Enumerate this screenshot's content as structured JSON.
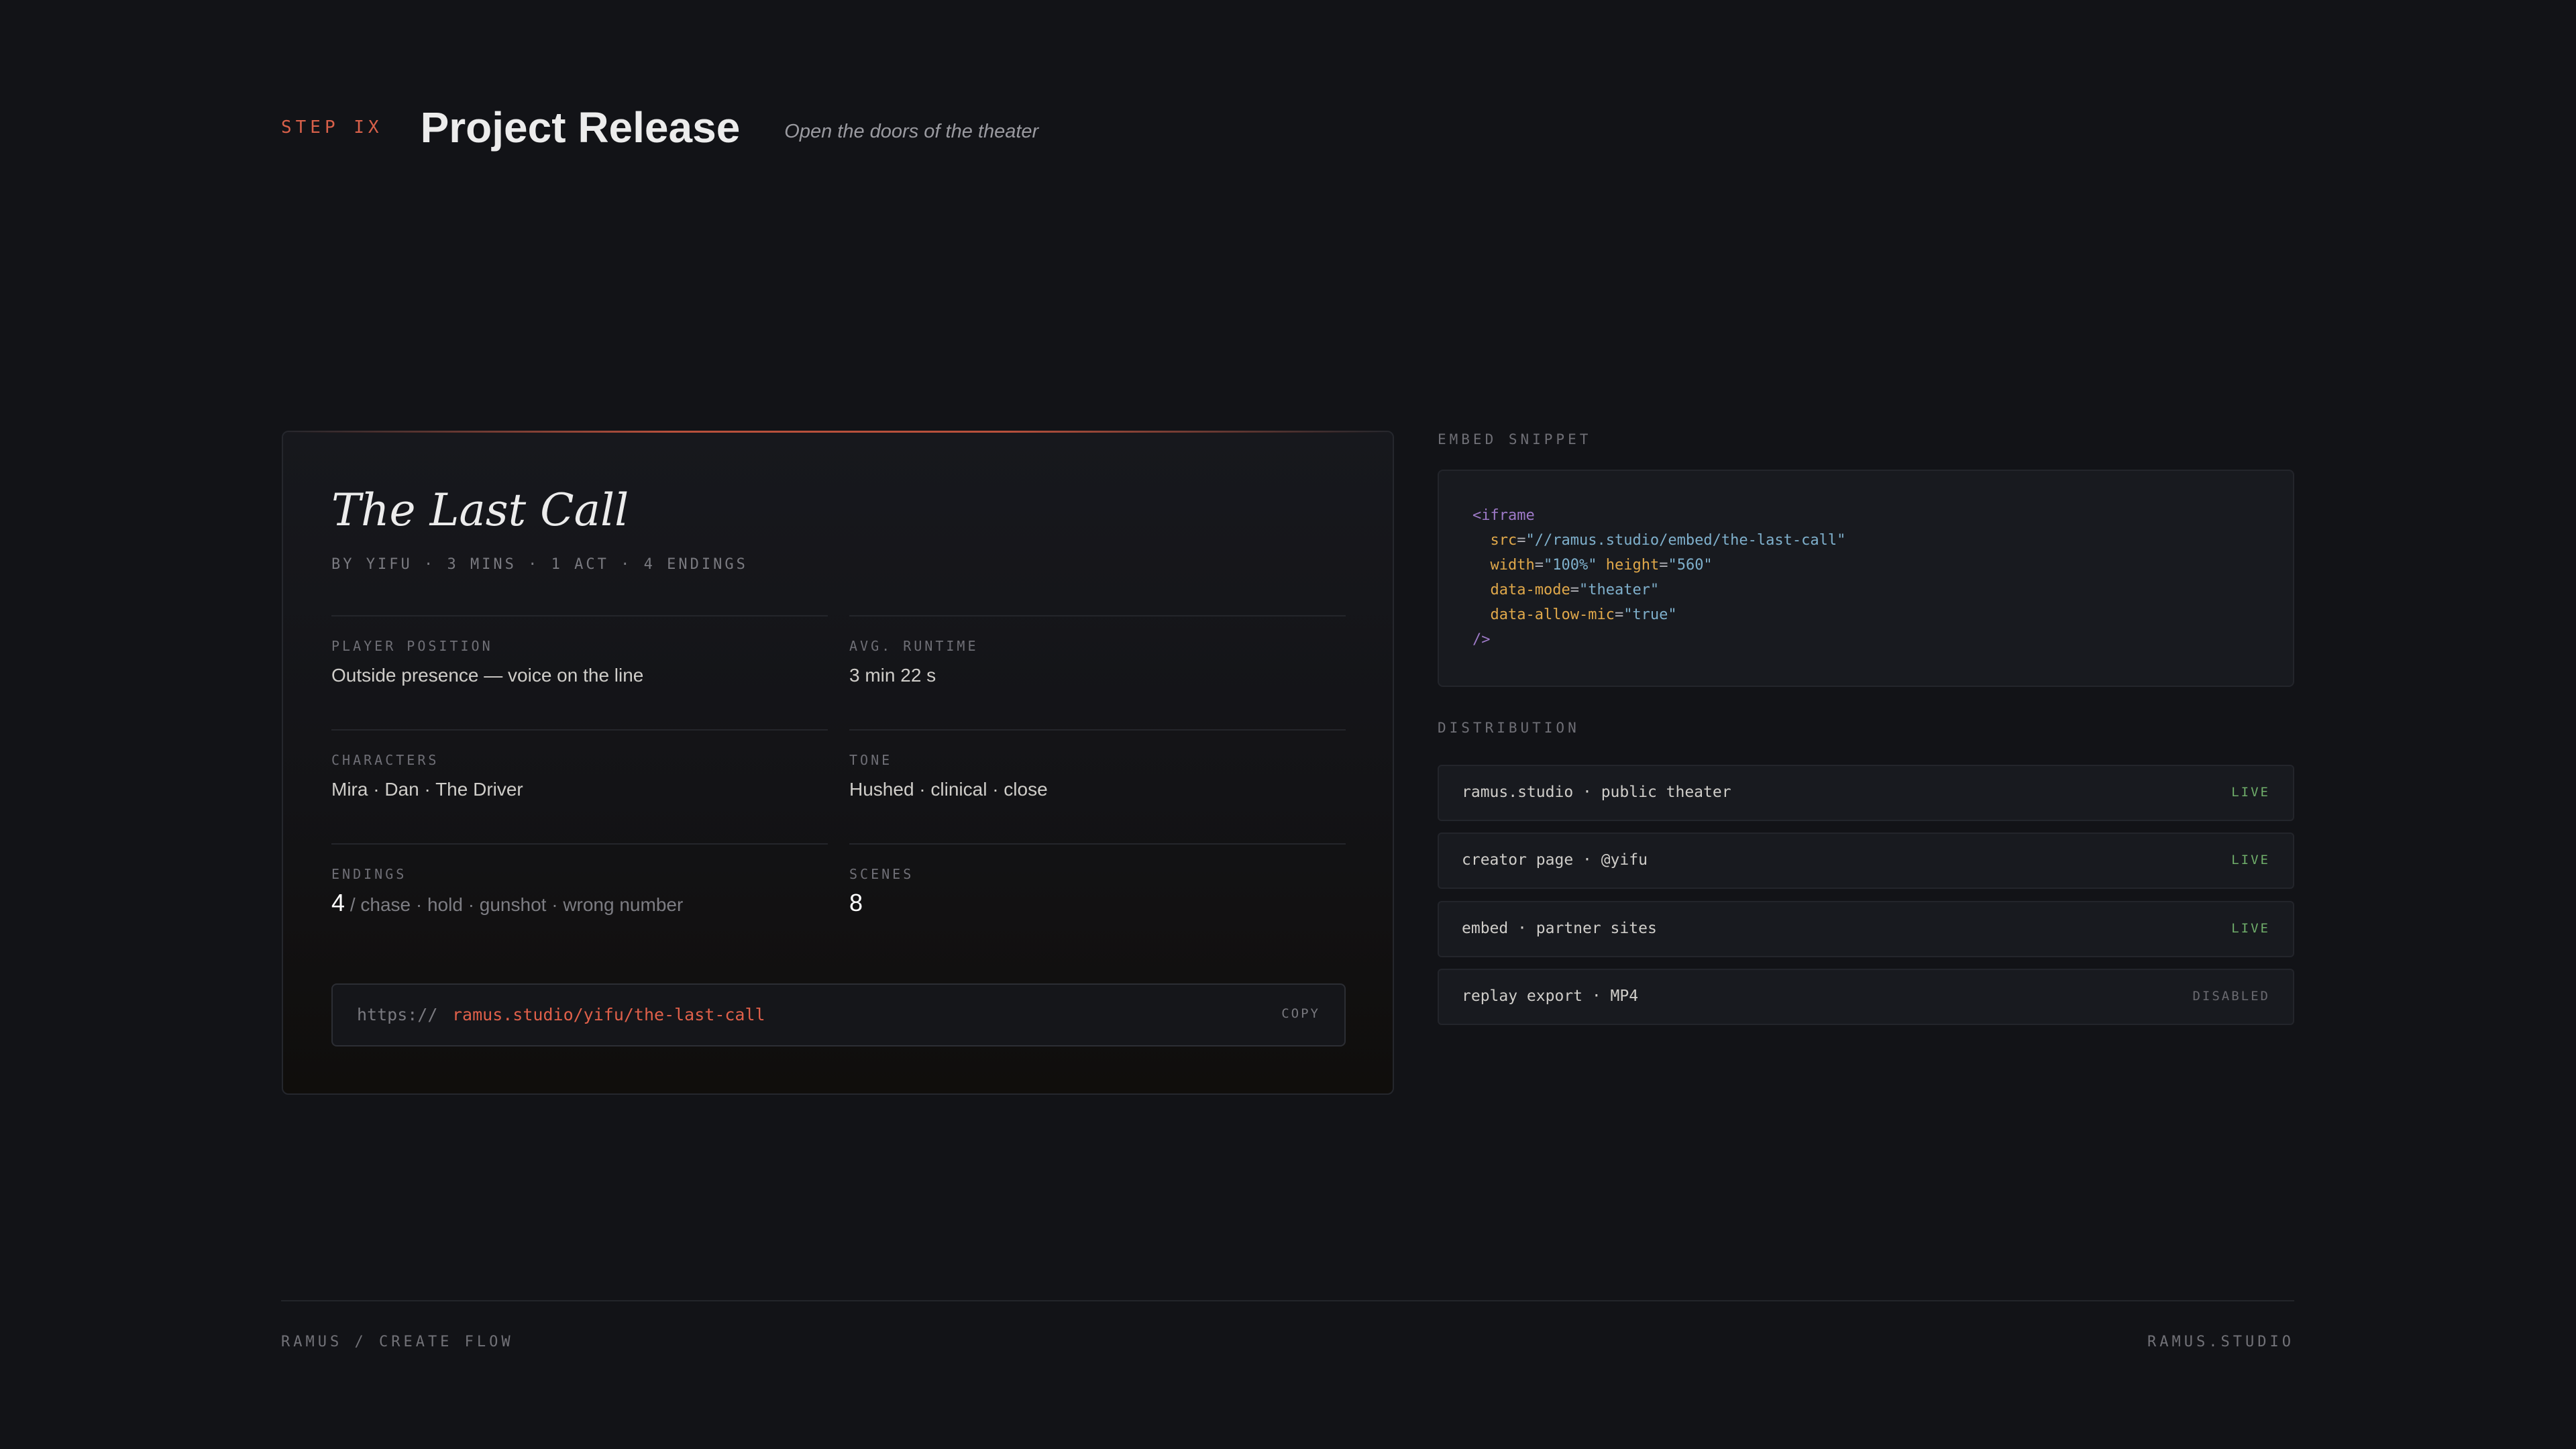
{
  "header": {
    "step": "STEP IX",
    "title": "Project Release",
    "subtitle": "Open the doors of the theater"
  },
  "card": {
    "title": "The Last Call",
    "meta": "BY YIFU · 3 MINS · 1 ACT · 4 ENDINGS",
    "fields": {
      "player_position": {
        "label": "PLAYER POSITION",
        "value": "Outside presence — voice on the line"
      },
      "avg_runtime": {
        "label": "AVG. RUNTIME",
        "value": "3 min 22 s"
      },
      "characters": {
        "label": "CHARACTERS",
        "value": "Mira · Dan · The Driver"
      },
      "tone": {
        "label": "TONE",
        "value": "Hushed · clinical · close"
      },
      "endings": {
        "label": "ENDINGS",
        "count": "4",
        "list": "/ chase · hold · gunshot · wrong number"
      },
      "scenes": {
        "label": "SCENES",
        "value": "8"
      }
    },
    "url": {
      "prefix": "https://",
      "path": "ramus.studio/yifu/the-last-call",
      "copy_label": "COPY"
    }
  },
  "embed": {
    "label": "EMBED SNIPPET",
    "code": {
      "open_tag": "<iframe",
      "src_attr": "src",
      "src_val": "\"//ramus.studio/embed/the-last-call\"",
      "width_attr": "width",
      "width_val": "\"100%\"",
      "height_attr": "height",
      "height_val": "\"560\"",
      "mode_attr": "data-mode",
      "mode_val": "\"theater\"",
      "mic_attr": "data-allow-mic",
      "mic_val": "\"true\"",
      "close_tag": "/>"
    }
  },
  "distribution": {
    "label": "DISTRIBUTION",
    "items": [
      {
        "name": "ramus.studio · public theater",
        "status": "LIVE"
      },
      {
        "name": "creator page · @yifu",
        "status": "LIVE"
      },
      {
        "name": "embed · partner sites",
        "status": "LIVE"
      },
      {
        "name": "replay export · MP4",
        "status": "DISABLED"
      }
    ]
  },
  "footer": {
    "left": "RAMUS / CREATE FLOW",
    "right": "RAMUS.STUDIO"
  },
  "colors": {
    "accent": "#d8604a",
    "live": "#6fae6a",
    "disabled": "#6a6a70",
    "background": "#121317"
  }
}
